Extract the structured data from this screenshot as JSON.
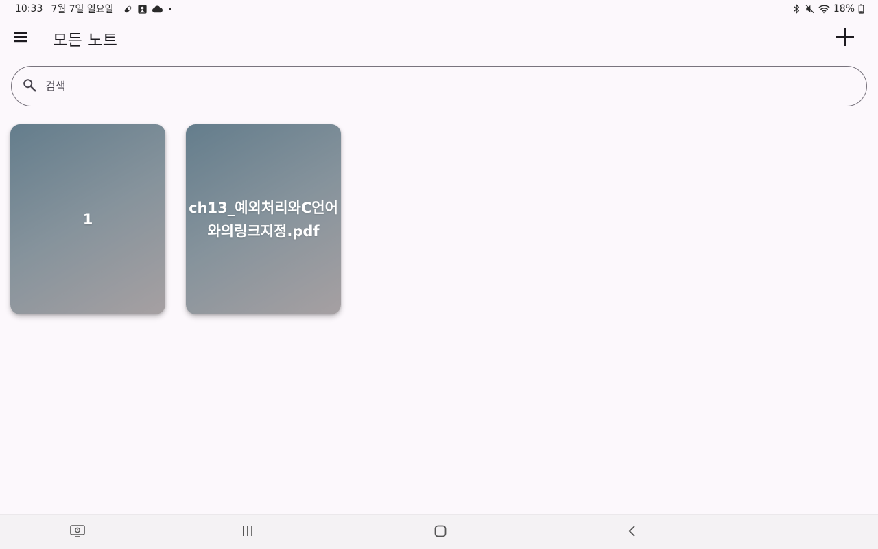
{
  "status_bar": {
    "time": "10:33",
    "date": "7월 7일 일요일",
    "left_icons": [
      "pill-icon",
      "image-icon",
      "cloud-icon",
      "dot-icon"
    ],
    "right_icons": [
      "bluetooth-icon",
      "mute-icon",
      "wifi-icon"
    ],
    "battery": "18%"
  },
  "header": {
    "title": "모든 노트"
  },
  "search": {
    "placeholder": "검색",
    "value": ""
  },
  "notes": [
    {
      "title": "1"
    },
    {
      "title": "ch13_예외처리와C언어와의링크지정.pdf"
    }
  ],
  "colors": {
    "background": "#fcf8fc",
    "card_gradient_start": "#647d8c",
    "card_gradient_end": "#a6a0a2",
    "nav_bar": "#f4f2f4"
  }
}
